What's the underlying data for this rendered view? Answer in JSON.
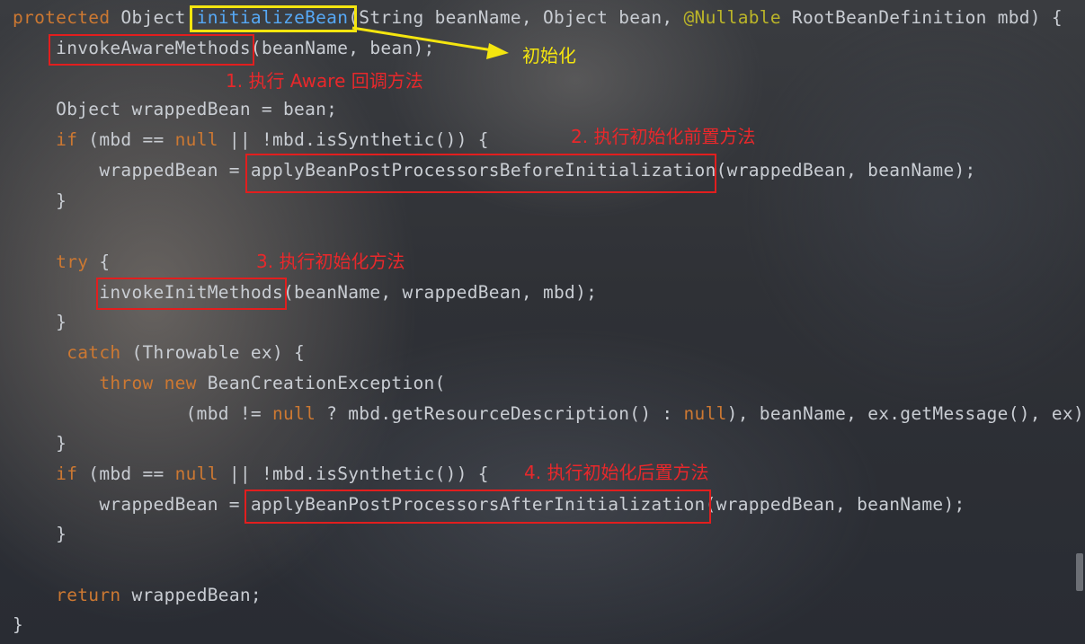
{
  "code": {
    "l1": {
      "kw": "protected",
      "type": " Object ",
      "method": "initializeBean",
      "rest1": "(String beanName, Object bean, ",
      "annotation": "@Nullable",
      "rest2": " RootBeanDefinition mbd) {"
    },
    "l2": {
      "indent": "    ",
      "call": "invokeAwareMethods",
      "rest": "(beanName, bean);"
    },
    "l3": {
      "text": "    Object wrappedBean = bean;"
    },
    "l4": {
      "indent": "    ",
      "kw_if": "if",
      "p1": " (mbd == ",
      "kw_null": "null",
      "p2": " || !mbd.isSynthetic()) {"
    },
    "l5": {
      "indent": "        ",
      "pre": "wrappedBean = ",
      "call": "applyBeanPostProcessorsBeforeInitialization",
      "rest": "(wrappedBean, beanName);"
    },
    "l6": {
      "text": "    }"
    },
    "l7": {
      "indent": "    ",
      "kw_try": "try",
      "rest": " {"
    },
    "l8": {
      "indent": "        ",
      "call": "invokeInitMethods",
      "rest": "(beanName, wrappedBean, mbd);"
    },
    "l9": {
      "text": "    }"
    },
    "l10": {
      "indent": "     ",
      "kw_catch": "catch",
      "rest": " (Throwable ex) {"
    },
    "l11": {
      "indent": "        ",
      "kw_throw": "throw",
      "sp": " ",
      "kw_new": "new",
      "rest": " BeanCreationException("
    },
    "l12": {
      "indent": "                ",
      "p1": "(mbd != ",
      "kw_null1": "null",
      "p2": " ? mbd.getResourceDescription() : ",
      "kw_null2": "null",
      "p3": "), beanName, ex.getMessage(), ex);"
    },
    "l13": {
      "text": "    }"
    },
    "l14": {
      "indent": "    ",
      "kw_if": "if",
      "p1": " (mbd == ",
      "kw_null": "null",
      "p2": " || !mbd.isSynthetic()) {"
    },
    "l15": {
      "indent": "        ",
      "pre": "wrappedBean = ",
      "call": "applyBeanPostProcessorsAfterInitialization",
      "rest": "(wrappedBean, beanName);"
    },
    "l16": {
      "text": "    }"
    },
    "l17": {
      "indent": "    ",
      "kw_return": "return",
      "rest": " wrappedBean;"
    },
    "l18": {
      "text": "}"
    }
  },
  "annotations": {
    "init": "初始化",
    "step1": "1. 执行 Aware 回调方法",
    "step2": "2. 执行初始化前置方法",
    "step3": "3. 执行初始化方法",
    "step4": "4. 执行初始化后置方法"
  },
  "colors": {
    "keyword": "#cc7832",
    "annotation": "#bbb529",
    "method_declaration": "#56a8f5",
    "highlight_box": "#e21e1e",
    "init_box": "#f4e50f"
  }
}
